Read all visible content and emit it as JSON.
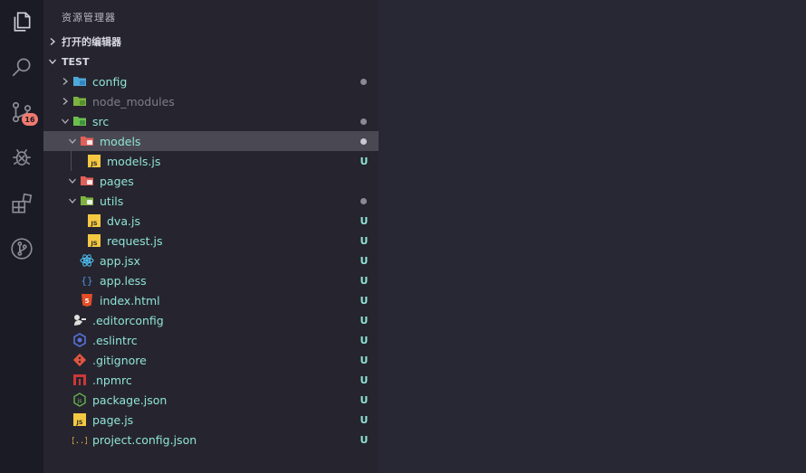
{
  "activity_bar": {
    "icons": [
      "explorer-icon",
      "search-icon",
      "source-control-icon",
      "debug-icon",
      "extensions-icon",
      "git-graph-icon"
    ],
    "source_control_badge": "16"
  },
  "sidebar": {
    "title": "资源管理器",
    "open_editors": "打开的编辑器",
    "workspace": "TEST",
    "tree": [
      {
        "label": "config",
        "type": "folder",
        "expanded": false,
        "depth": 1,
        "status": "dot"
      },
      {
        "label": "node_modules",
        "type": "folder",
        "expanded": false,
        "depth": 1,
        "status": ""
      },
      {
        "label": "src",
        "type": "folder",
        "expanded": true,
        "depth": 1,
        "status": "dot"
      },
      {
        "label": "models",
        "type": "folder",
        "expanded": true,
        "depth": 2,
        "status": "dot",
        "selected": true
      },
      {
        "label": "models.js",
        "type": "js",
        "depth": 3,
        "status": "U"
      },
      {
        "label": "pages",
        "type": "folder",
        "expanded": true,
        "depth": 2,
        "status": ""
      },
      {
        "label": "utils",
        "type": "folder",
        "expanded": true,
        "depth": 2,
        "status": "dot"
      },
      {
        "label": "dva.js",
        "type": "js",
        "depth": 3,
        "status": "U"
      },
      {
        "label": "request.js",
        "type": "js",
        "depth": 3,
        "status": "U"
      },
      {
        "label": "app.jsx",
        "type": "react",
        "depth": 2,
        "status": "U"
      },
      {
        "label": "app.less",
        "type": "less",
        "depth": 2,
        "status": "U"
      },
      {
        "label": "index.html",
        "type": "html",
        "depth": 2,
        "status": "U"
      },
      {
        "label": ".editorconfig",
        "type": "editorconfig",
        "depth": 1,
        "status": "U"
      },
      {
        "label": ".eslintrc",
        "type": "eslint",
        "depth": 1,
        "status": "U"
      },
      {
        "label": ".gitignore",
        "type": "git",
        "depth": 1,
        "status": "U"
      },
      {
        "label": ".npmrc",
        "type": "npm",
        "depth": 1,
        "status": "U"
      },
      {
        "label": "package.json",
        "type": "node",
        "depth": 1,
        "status": "U"
      },
      {
        "label": "page.js",
        "type": "js",
        "depth": 1,
        "status": "U"
      },
      {
        "label": "project.config.json",
        "type": "json",
        "depth": 1,
        "status": "U"
      }
    ]
  },
  "colors": {
    "activity_bg": "#1b1b26",
    "sidebar_bg": "#26252f",
    "editor_bg": "#282834",
    "selection": "#4a4953",
    "untracked": "#8fe3d6",
    "badge": "#f07a6e"
  }
}
